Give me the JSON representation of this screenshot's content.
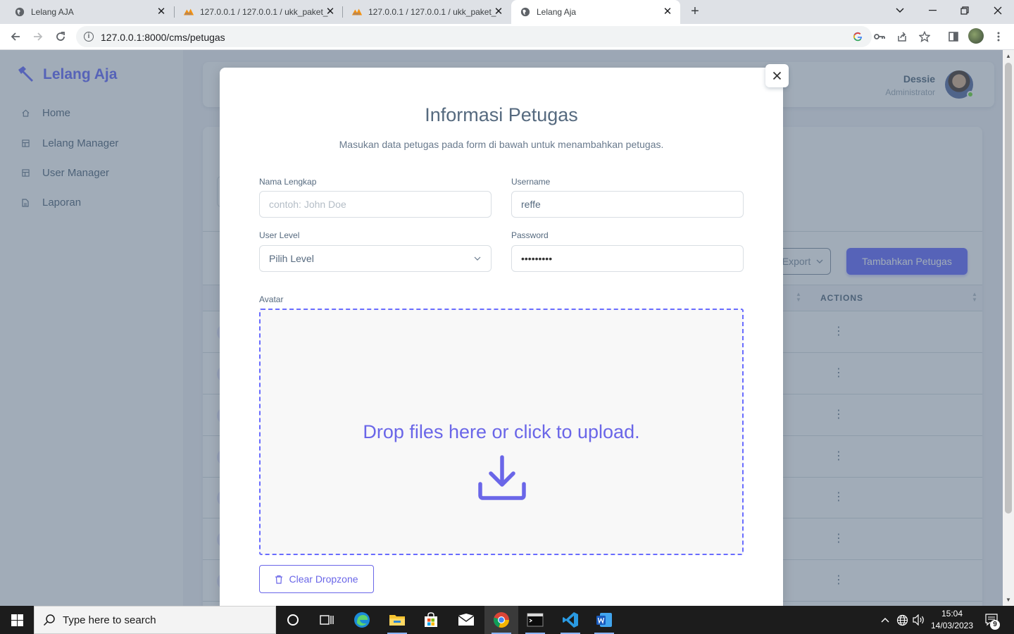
{
  "browser": {
    "tabs": [
      {
        "title": "Lelang AJA",
        "favicon": "globe-icon",
        "active": false
      },
      {
        "title": "127.0.0.1 / 127.0.0.1 / ukk_paket_",
        "favicon": "phpmyadmin-icon",
        "active": false
      },
      {
        "title": "127.0.0.1 / 127.0.0.1 / ukk_paket_",
        "favicon": "phpmyadmin-icon",
        "active": false
      },
      {
        "title": "Lelang Aja",
        "favicon": "globe-icon",
        "active": true
      }
    ],
    "url": "127.0.0.1:8000/cms/petugas"
  },
  "sidebar": {
    "brand": "Lelang Aja",
    "items": [
      {
        "label": "Home",
        "icon": "home-icon"
      },
      {
        "label": "Lelang Manager",
        "icon": "table-icon"
      },
      {
        "label": "User Manager",
        "icon": "table-icon"
      },
      {
        "label": "Laporan",
        "icon": "file-icon"
      }
    ]
  },
  "navbar": {
    "user_name": "Dessie",
    "user_role": "Administrator"
  },
  "main": {
    "export_label": "Export",
    "add_label": "Tambahkan Petugas",
    "actions_header": "ACTIONS",
    "row_count": 7
  },
  "modal": {
    "title": "Informasi Petugas",
    "subtitle": "Masukan data petugas pada form di bawah untuk menambahkan petugas.",
    "fields": {
      "nama_label": "Nama Lengkap",
      "nama_placeholder": "contoh: John Doe",
      "nama_value": "",
      "username_label": "Username",
      "username_value": "reffe",
      "level_label": "User Level",
      "level_value": "Pilih Level",
      "password_label": "Password",
      "password_value": "•••••••••",
      "avatar_label": "Avatar"
    },
    "dropzone_text": "Drop files here or click to upload.",
    "clear_label": "Clear Dropzone"
  },
  "taskbar": {
    "search_placeholder": "Type here to search",
    "time": "15:04",
    "date": "14/03/2023",
    "notification_count": "9"
  },
  "colors": {
    "primary": "#696cff",
    "dropzone": "#6a66e8",
    "text": "#566a7f"
  }
}
